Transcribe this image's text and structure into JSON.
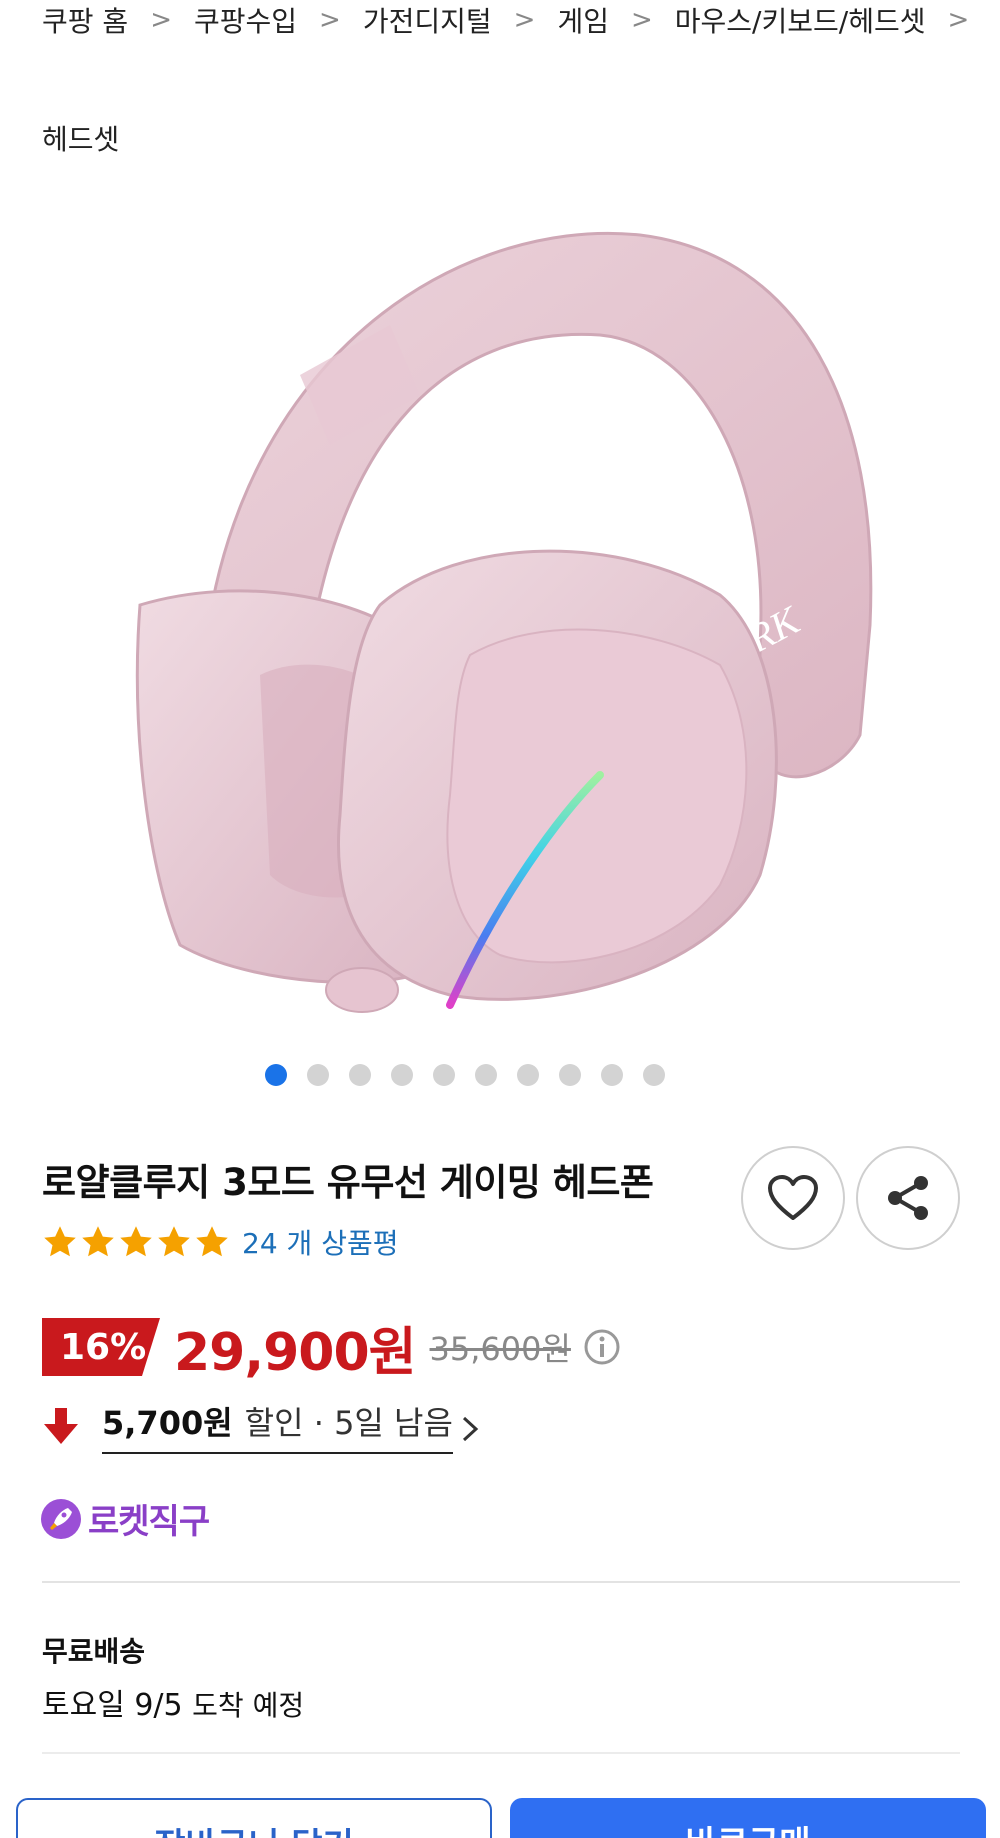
{
  "breadcrumb": {
    "items": [
      "쿠팡 홈",
      "쿠팡수입",
      "가전디지털",
      "게임",
      "마우스/키보드/헤드셋"
    ],
    "last": "헤드셋"
  },
  "gallery": {
    "image_count": 10,
    "active_index": 0,
    "logo_text": "RK"
  },
  "product": {
    "title": "로얄클루지 3모드 유무선 게이밍 헤드폰",
    "rating_stars": 5,
    "review_count": "24 개 상품평"
  },
  "price": {
    "discount_rate": "16%",
    "sale_price": "29,900원",
    "original_price": "35,600원"
  },
  "coupon": {
    "amount": "5,700원",
    "suffix": "할인 · 5일 남음"
  },
  "badge": {
    "rocket_label": "로켓직구"
  },
  "shipping": {
    "title": "무료배송",
    "date_main": "토요일 9/5",
    "date_sub": "도착 예정"
  },
  "actions": {
    "cart_label": "장바구니 담기",
    "buy_label": "바로구매"
  },
  "icons": {
    "wishlist": "heart-icon",
    "share": "share-icon",
    "info": "info-icon",
    "coupon": "down-arrow-icon",
    "rocket": "rocket-icon"
  },
  "colors": {
    "accent_blue": "#2f6ff2",
    "sale_red": "#c9191d",
    "star_orange": "#f5a100",
    "rocket_purple": "#8a3fc7",
    "link_blue": "#1c6fb8"
  }
}
